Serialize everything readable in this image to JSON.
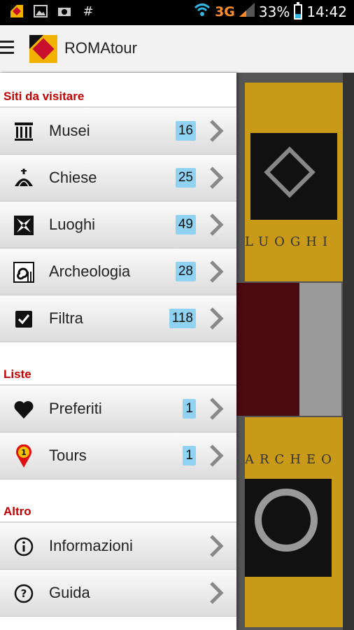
{
  "status_bar": {
    "network": "3G",
    "battery": "33%",
    "battery_level": 0.33,
    "time": "14:42",
    "left_icons": [
      "app-notification-icon",
      "image-icon",
      "camera-icon",
      "hash-icon"
    ]
  },
  "app_bar": {
    "title": "ROMAtour",
    "menu_icon": "hamburger-icon"
  },
  "drawer": {
    "sections": [
      {
        "title": "Siti da visitare",
        "items": [
          {
            "label": "Musei",
            "count": "16",
            "icon": "museum-icon"
          },
          {
            "label": "Chiese",
            "count": "25",
            "icon": "church-icon"
          },
          {
            "label": "Luoghi",
            "count": "49",
            "icon": "places-icon"
          },
          {
            "label": "Archeologia",
            "count": "28",
            "icon": "archaeology-icon"
          },
          {
            "label": "Filtra",
            "count": "118",
            "icon": "checkbox-icon"
          }
        ]
      },
      {
        "title": "Liste",
        "items": [
          {
            "label": "Preferiti",
            "count": "1",
            "icon": "heart-icon"
          },
          {
            "label": "Tours",
            "count": "1",
            "icon": "map-pin-icon"
          }
        ]
      },
      {
        "title": "Altro",
        "items": [
          {
            "label": "Informazioni",
            "icon": "info-icon"
          },
          {
            "label": "Guida",
            "icon": "help-icon"
          }
        ]
      }
    ]
  },
  "background": {
    "tile1_label": "LUOGHI",
    "tile2_label": "ARCHEO"
  },
  "colors": {
    "section_header": "#c00000",
    "badge": "#8fd2f2",
    "tile": "#c89a17"
  }
}
